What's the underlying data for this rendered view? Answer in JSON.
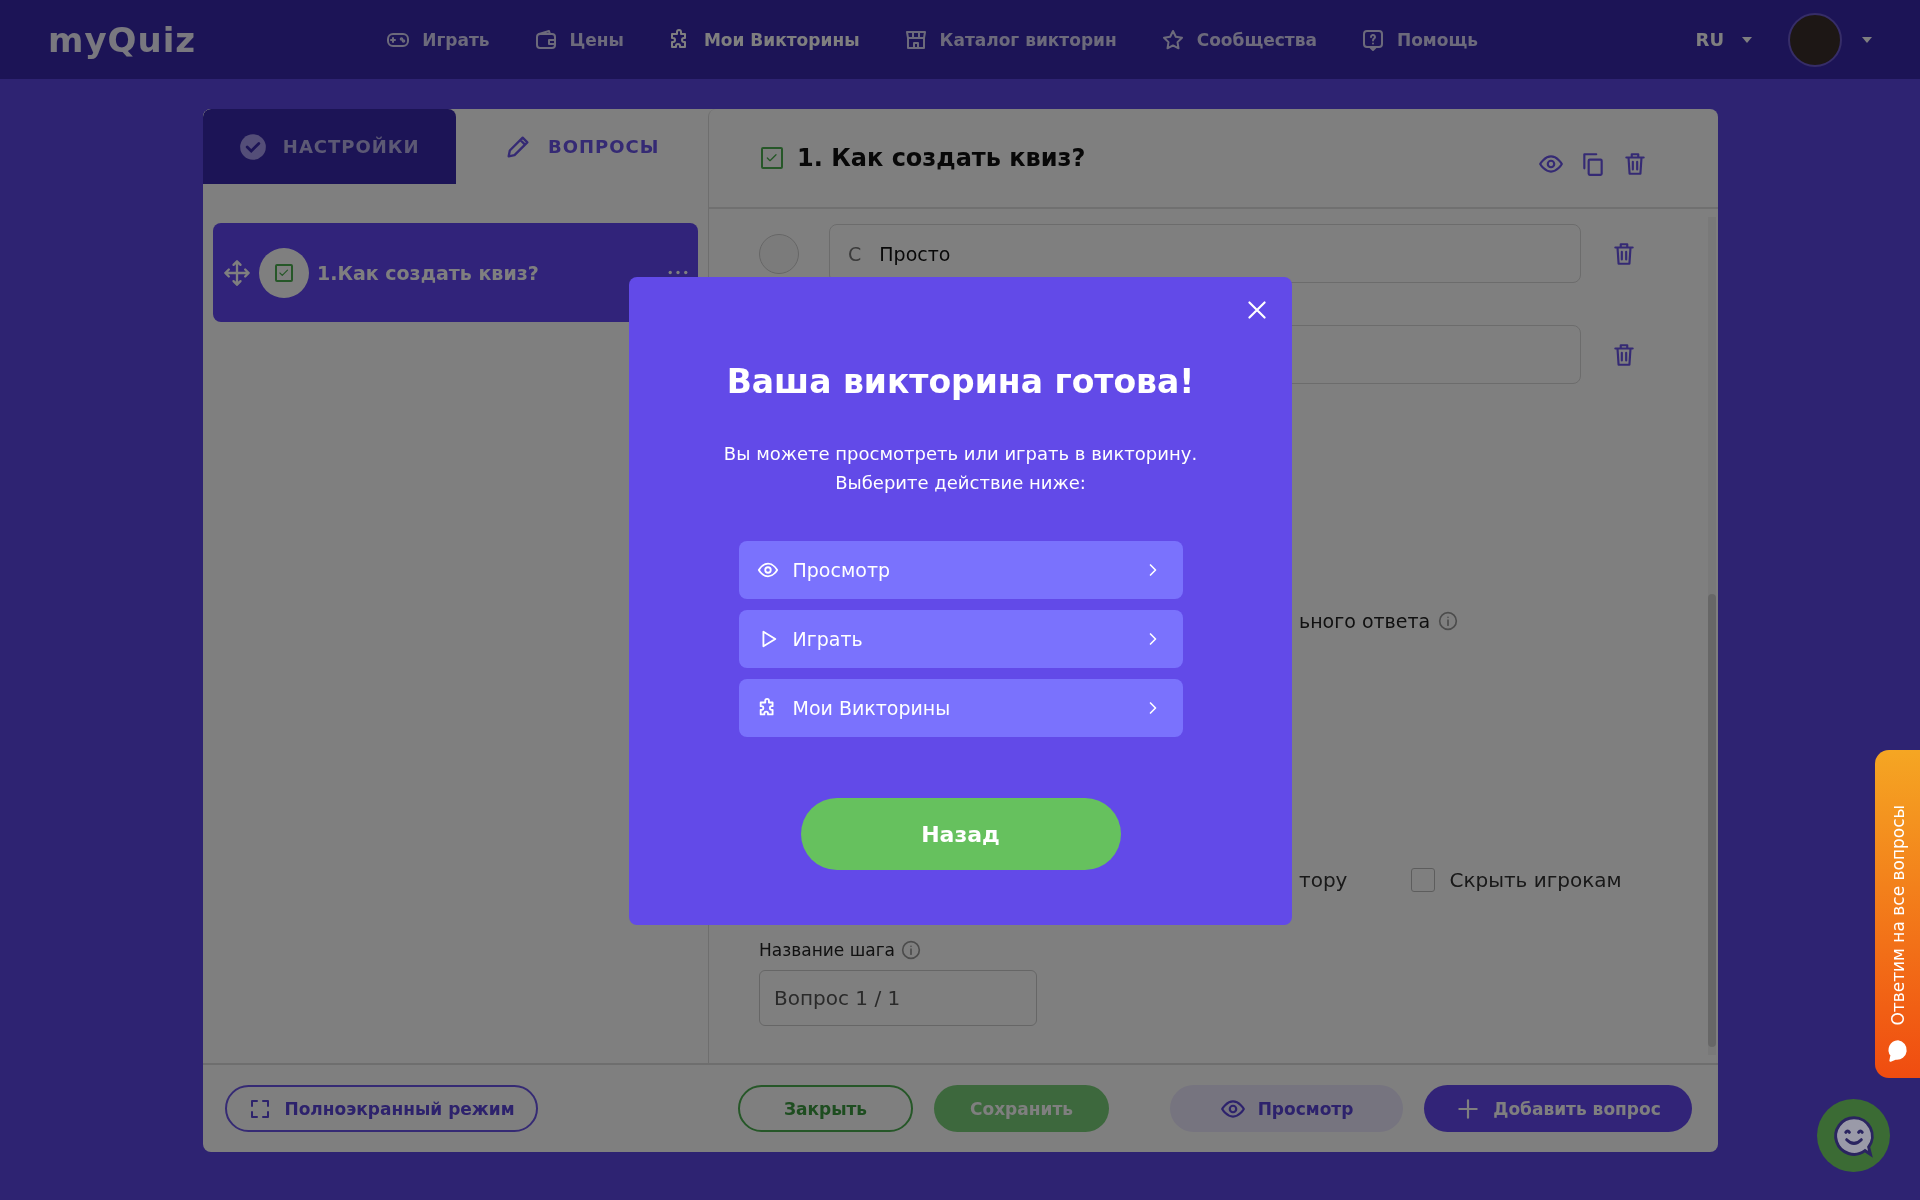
{
  "nav": {
    "logo": "myQuiz",
    "items": [
      {
        "label": "Играть",
        "selected": false
      },
      {
        "label": "Цены",
        "selected": false
      },
      {
        "label": "Мои Викторины",
        "selected": true
      },
      {
        "label": "Каталог викторин",
        "selected": false
      },
      {
        "label": "Сообщества",
        "selected": false
      },
      {
        "label": "Помощь",
        "selected": false
      }
    ],
    "language": "RU"
  },
  "tabs": [
    {
      "label": "НАСТРОЙКИ",
      "selected": false
    },
    {
      "label": "ВОПРОСЫ",
      "selected": true
    }
  ],
  "question_list": [
    {
      "title": "1.Как создать квиз?",
      "selected": true,
      "checked": true
    }
  ],
  "editor": {
    "title": "1. Как создать квиз?",
    "checked": true,
    "answers": [
      {
        "kind": "text",
        "prefix": "С",
        "value": "Просто",
        "selected": false
      },
      {
        "kind": "covered"
      }
    ],
    "partial_option": "ьного ответа",
    "partial_checkbox_label": "тору",
    "hide_from_players": {
      "label": "Скрыть игрокам",
      "checked": false
    },
    "step_name": {
      "label": "Название шага",
      "value": "Вопрос 1 / 1"
    }
  },
  "footer": {
    "fullscreen": "Полноэкранный режим",
    "close": "Закрыть",
    "save": "Сохранить",
    "preview": "Просмотр",
    "add": "Добавить вопрос"
  },
  "modal": {
    "title": "Ваша викторина готова!",
    "description_lines": [
      "Вы можете просмотреть или играть в викторину.",
      "Выберите действие ниже:"
    ],
    "options": [
      {
        "label": "Просмотр"
      },
      {
        "label": "Играть"
      },
      {
        "label": "Мои Викторины"
      }
    ],
    "back": "Назад"
  },
  "help_tab": "Ответим на все вопросы"
}
